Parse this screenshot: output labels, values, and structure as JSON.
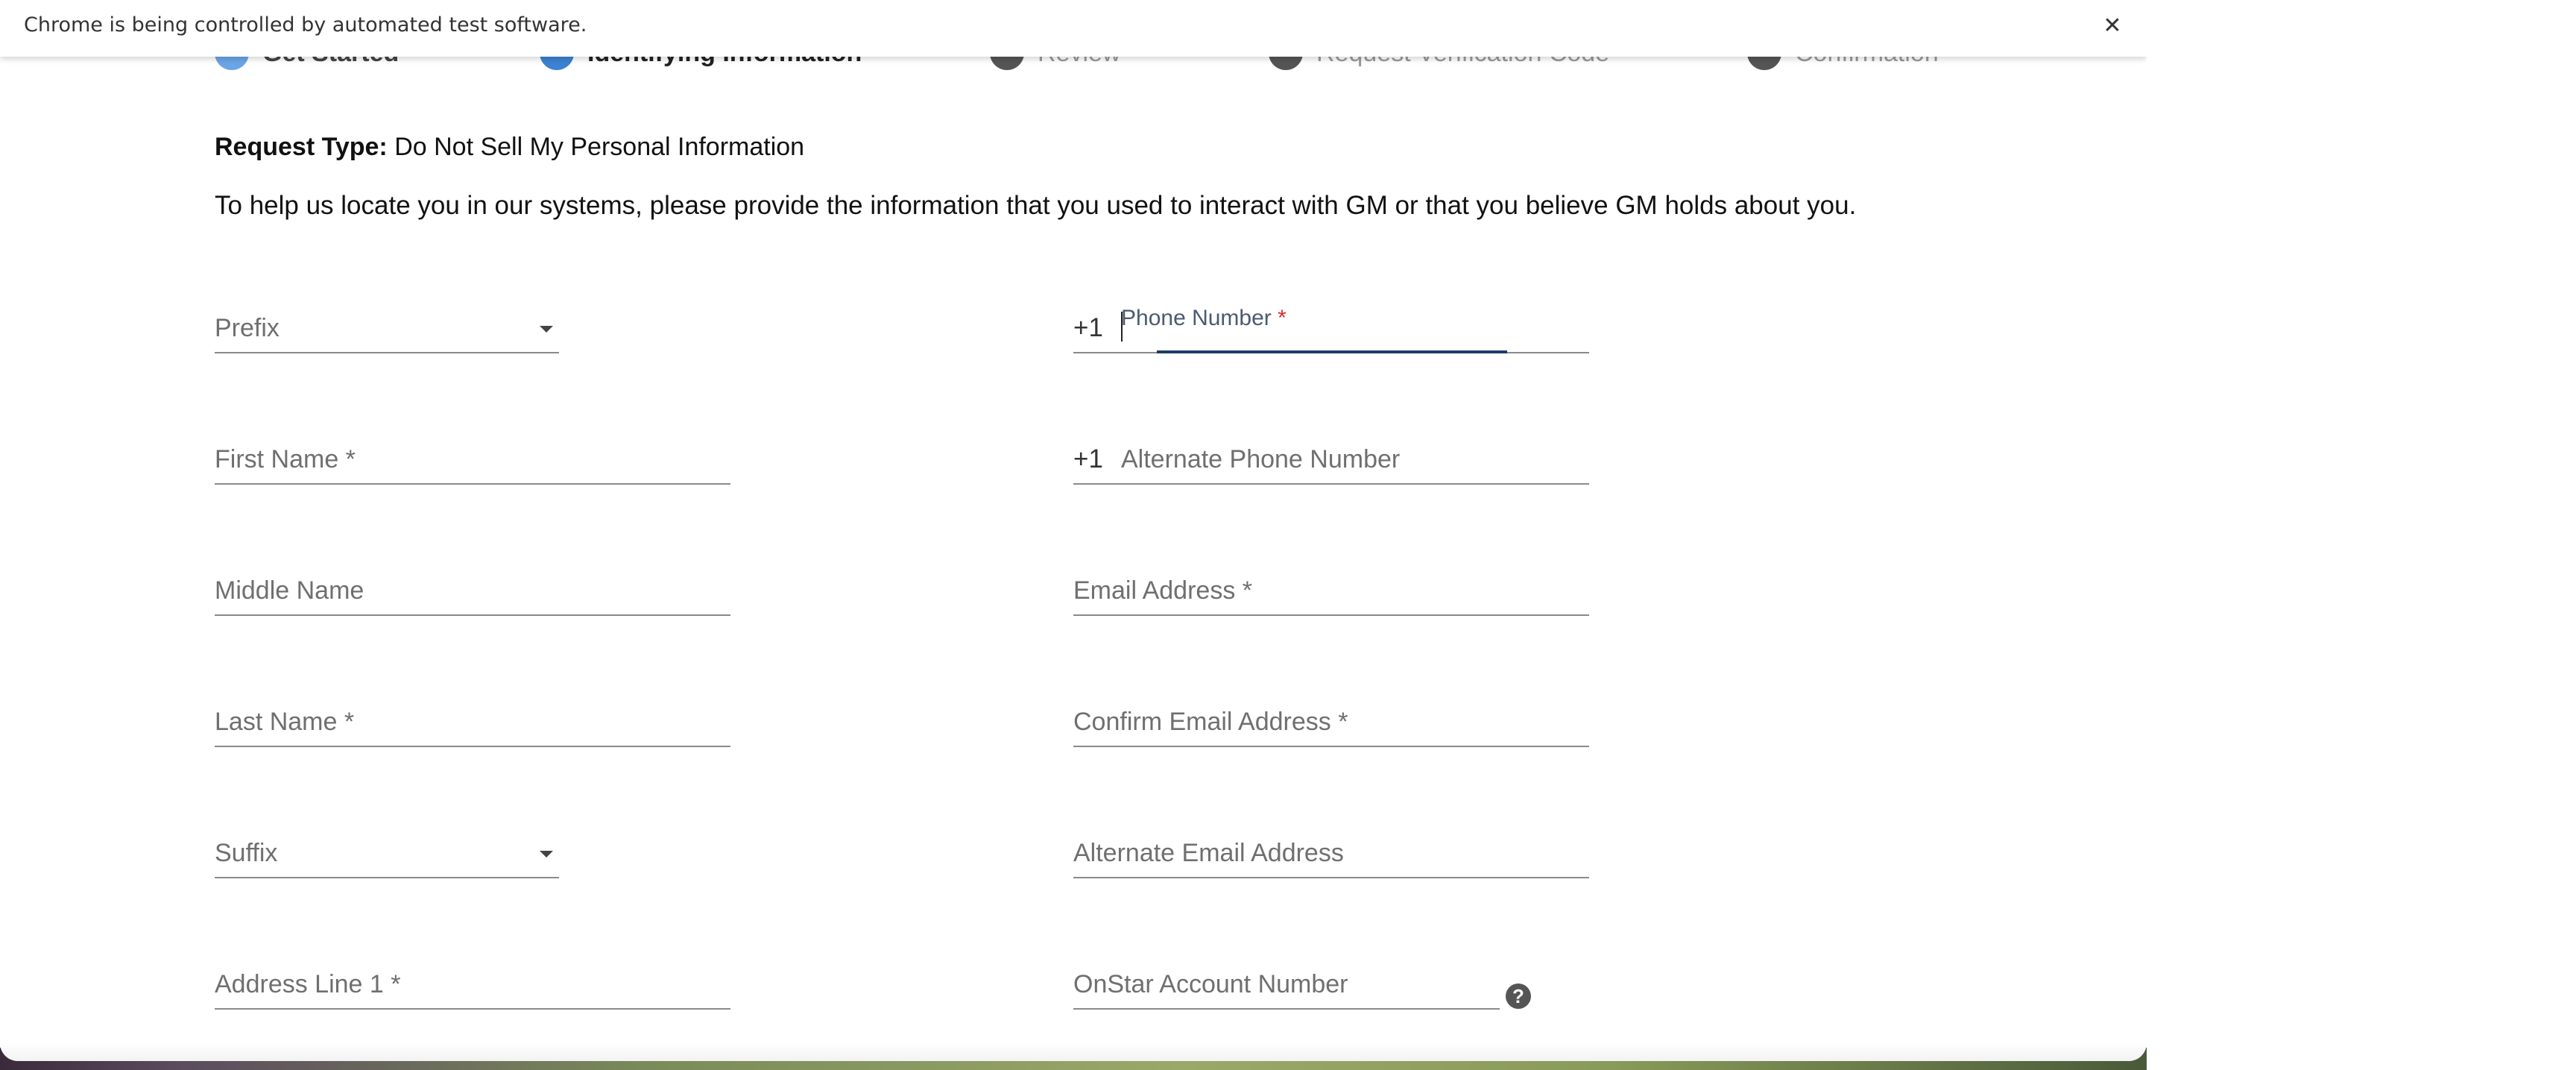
{
  "infobar": {
    "message": "Chrome is being controlled by automated test software.",
    "close_glyph": "✕"
  },
  "stepper": {
    "steps": [
      {
        "label": "Get Started",
        "state": "done"
      },
      {
        "label": "Identifying Information",
        "state": "active"
      },
      {
        "label": "Review",
        "state": "todo"
      },
      {
        "label": "Request Verification Code",
        "state": "todo"
      },
      {
        "label": "Confirmation",
        "state": "todo"
      }
    ]
  },
  "request": {
    "type_label": "Request Type:",
    "type_value": " Do Not Sell My Personal Information"
  },
  "help_text": "To help us locate you in our systems, please provide the information that you used to interact with GM or that you believe GM holds about you.",
  "form": {
    "prefix": {
      "label": "Prefix",
      "value": ""
    },
    "first_name": {
      "label": "First Name *",
      "value": ""
    },
    "middle_name": {
      "label": "Middle Name",
      "value": ""
    },
    "last_name": {
      "label": "Last Name *",
      "value": ""
    },
    "suffix": {
      "label": "Suffix",
      "value": ""
    },
    "address_line_1": {
      "label": "Address Line 1 *",
      "value": ""
    },
    "phone": {
      "country_code": "+1",
      "label": "Phone Number",
      "required_mark": "*",
      "value": ""
    },
    "alt_phone": {
      "country_code": "+1",
      "label": "Alternate Phone Number",
      "value": ""
    },
    "email": {
      "label": "Email Address *",
      "value": ""
    },
    "confirm_email": {
      "label": "Confirm Email Address *",
      "value": ""
    },
    "alt_email": {
      "label": "Alternate Email Address",
      "value": ""
    },
    "onstar": {
      "label": "OnStar Account Number",
      "value": "",
      "help_glyph": "?"
    }
  },
  "colors": {
    "accent": "#1f3a6e",
    "step_active": "#3d82d4",
    "required": "#d32f2f"
  }
}
